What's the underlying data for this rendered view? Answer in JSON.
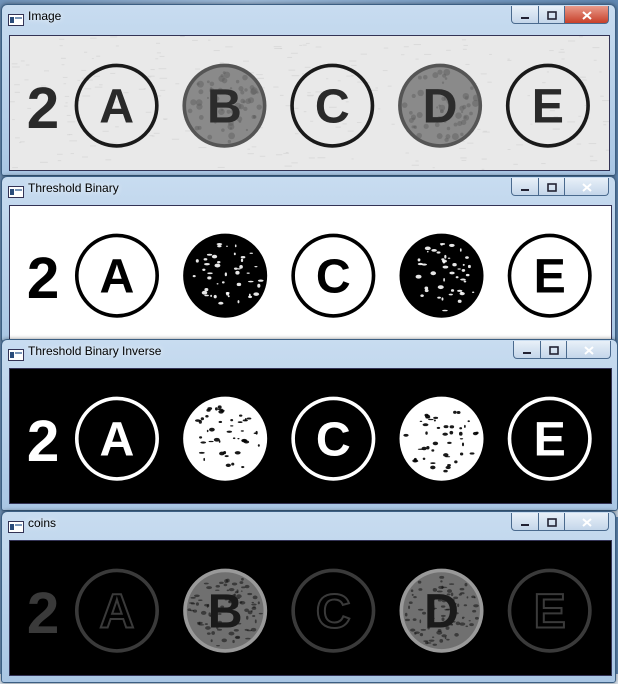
{
  "windows": [
    {
      "title": "Image",
      "active": true,
      "mode": "original"
    },
    {
      "title": "Threshold Binary",
      "active": false,
      "mode": "binary"
    },
    {
      "title": "Threshold Binary Inverse",
      "active": false,
      "mode": "inverse"
    },
    {
      "title": "coins",
      "active": false,
      "mode": "coins"
    }
  ],
  "answer_sheet": {
    "question_number": "2",
    "options": [
      "A",
      "B",
      "C",
      "D",
      "E"
    ],
    "filled_options": [
      "B",
      "D"
    ]
  },
  "icons": {
    "window_icon": "opencv-window-icon",
    "minimize": "minimize-icon",
    "maximize": "maximize-icon",
    "close": "close-icon"
  }
}
